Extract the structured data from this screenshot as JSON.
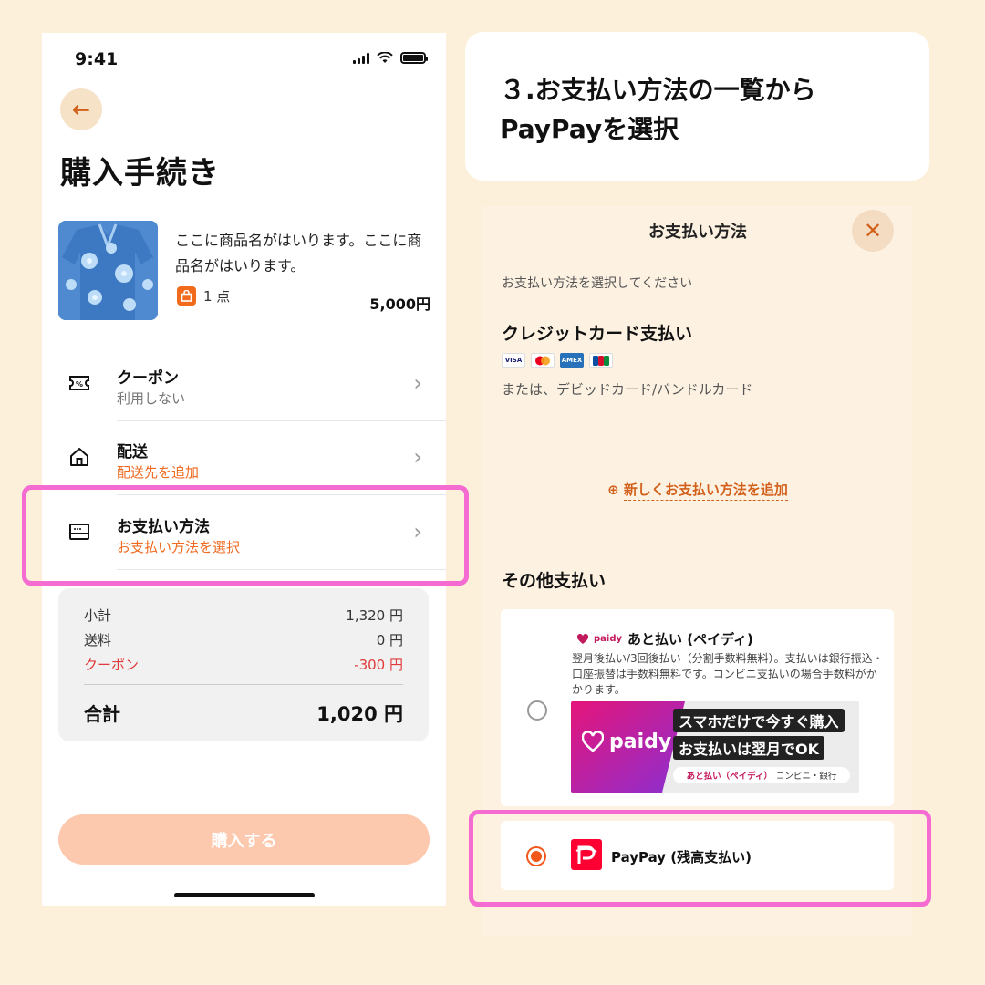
{
  "status_bar": {
    "time": "9:41"
  },
  "purchase": {
    "back_icon": "arrow-left-icon",
    "title": "購入手続き",
    "product": {
      "name": "ここに商品名がはいります。ここに商品名がはいります。",
      "quantity": "1 点",
      "price": "5,000円"
    },
    "rows": [
      {
        "title": "クーポン",
        "sub": "利用しない",
        "icon": "coupon-icon"
      },
      {
        "title": "配送",
        "sub": "配送先を追加",
        "icon": "home-icon"
      },
      {
        "title": "お支払い方法",
        "sub": "お支払い方法を選択",
        "icon": "card-icon"
      }
    ],
    "summary": {
      "subtotal_label": "小計",
      "subtotal_value": "1,320 円",
      "shipping_label": "送料",
      "shipping_value": "0 円",
      "coupon_label": "クーポン",
      "coupon_value": "-300 円",
      "total_label": "合計",
      "total_value": "1,020 円"
    },
    "buy_button": "購入する"
  },
  "caption": {
    "line1": "３.お支払い方法の一覧から",
    "line2": "PayPayを選択"
  },
  "payment_sheet": {
    "title": "お支払い方法",
    "close_icon": "close-icon",
    "instruction": "お支払い方法を選択してください",
    "credit_title": "クレジットカード支払い",
    "card_brands": [
      "VISA",
      "MC",
      "AMEX",
      "JCB"
    ],
    "credit_sub": "または、デビッドカード/バンドルカード",
    "add_method": "新しくお支払い方法を追加",
    "other_title": "その他支払い",
    "paidy": {
      "mini_logo": "paidy",
      "name": "あと払い (ペイディ)",
      "description": "翌月後払い/3回後払い（分割手数料無料）。支払いは銀行振込・口座振替は手数料無料です。コンビニ支払いの場合手数料がかかります。",
      "banner_logo": "paidy",
      "banner_line1": "スマホだけで今すぐ購入",
      "banner_line2": "お支払いは翌月でOK",
      "banner_pill_pink": "あと払い（ペイディ）",
      "banner_pill_dark": "コンビニ・銀行",
      "selected": false
    },
    "paypay": {
      "name": "PayPay (残高支払い)",
      "selected": true
    }
  },
  "colors": {
    "background": "#fdf0da",
    "accent_orange": "#ef6a20",
    "highlight_pink": "#f46bd1",
    "paypay_red": "#ff0033"
  }
}
